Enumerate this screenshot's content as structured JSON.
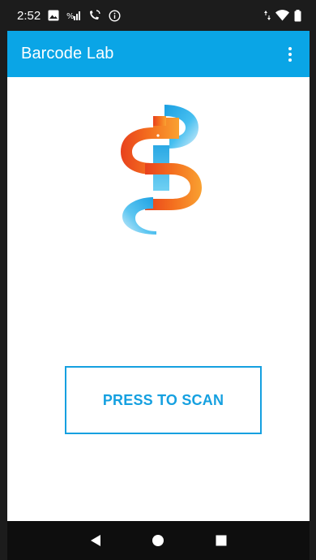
{
  "status_bar": {
    "time": "2:52",
    "icons_left": [
      "image-icon",
      "signal-volte-icon",
      "wifi-calling-icon",
      "info-icon"
    ],
    "icons_right": [
      "data-arrows-icon",
      "wifi-icon",
      "battery-icon"
    ]
  },
  "app_bar": {
    "title": "Barcode Lab",
    "overflow_icon": "more-vert-icon",
    "background": "#0aa5e6"
  },
  "main": {
    "logo_icon": "barcode-lab-logo",
    "scan_button_label": "PRESS TO SCAN",
    "accent": "#15a0e0"
  },
  "nav_bar": {
    "buttons": [
      "back-icon",
      "home-icon",
      "recents-icon"
    ]
  }
}
